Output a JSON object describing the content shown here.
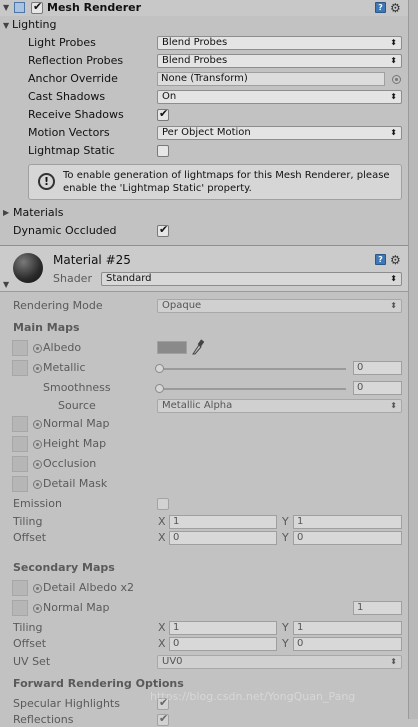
{
  "mesh_renderer": {
    "title": "Mesh Renderer",
    "lighting_label": "Lighting",
    "rows": {
      "light_probes": {
        "label": "Light Probes",
        "value": "Blend Probes"
      },
      "reflection_probes": {
        "label": "Reflection Probes",
        "value": "Blend Probes"
      },
      "anchor_override": {
        "label": "Anchor Override",
        "value": "None (Transform)"
      },
      "cast_shadows": {
        "label": "Cast Shadows",
        "value": "On"
      },
      "receive_shadows": {
        "label": "Receive Shadows",
        "checked": true
      },
      "motion_vectors": {
        "label": "Motion Vectors",
        "value": "Per Object Motion"
      },
      "lightmap_static": {
        "label": "Lightmap Static",
        "checked": false
      }
    },
    "info_text_line1": "To enable generation of lightmaps for this Mesh Renderer, please",
    "info_text_line2": "enable the 'Lightmap Static' property.",
    "materials_label": "Materials",
    "dynamic_occluded": {
      "label": "Dynamic Occluded",
      "checked": true
    }
  },
  "material": {
    "name": "Material #25",
    "shader_label": "Shader",
    "shader_value": "Standard",
    "rendering_mode": {
      "label": "Rendering Mode",
      "value": "Opaque"
    },
    "main_maps_label": "Main Maps",
    "albedo_label": "Albedo",
    "metallic_label": "Metallic",
    "metallic_value": "0",
    "smoothness_label": "Smoothness",
    "smoothness_value": "0",
    "source_label": "Source",
    "source_value": "Metallic Alpha",
    "normal_map_label": "Normal Map",
    "height_map_label": "Height Map",
    "occlusion_label": "Occlusion",
    "detail_mask_label": "Detail Mask",
    "emission_label": "Emission",
    "tiling_label": "Tiling",
    "offset_label": "Offset",
    "x_label": "X",
    "y_label": "Y",
    "main_tiling": {
      "x": "1",
      "y": "1"
    },
    "main_offset": {
      "x": "0",
      "y": "0"
    },
    "secondary_maps_label": "Secondary Maps",
    "detail_albedo_label": "Detail Albedo x2",
    "sec_normal_map_label": "Normal Map",
    "sec_normal_value": "1",
    "sec_tiling": {
      "x": "1",
      "y": "1"
    },
    "sec_offset": {
      "x": "0",
      "y": "0"
    },
    "uv_set_label": "UV Set",
    "uv_set_value": "UV0",
    "forward_label": "Forward Rendering Options",
    "specular_label": "Specular Highlights",
    "reflections_label": "Reflections",
    "albedo_color": "#8a8a8a"
  },
  "watermark": "https://blog.csdn.net/YongQuan_Pang"
}
